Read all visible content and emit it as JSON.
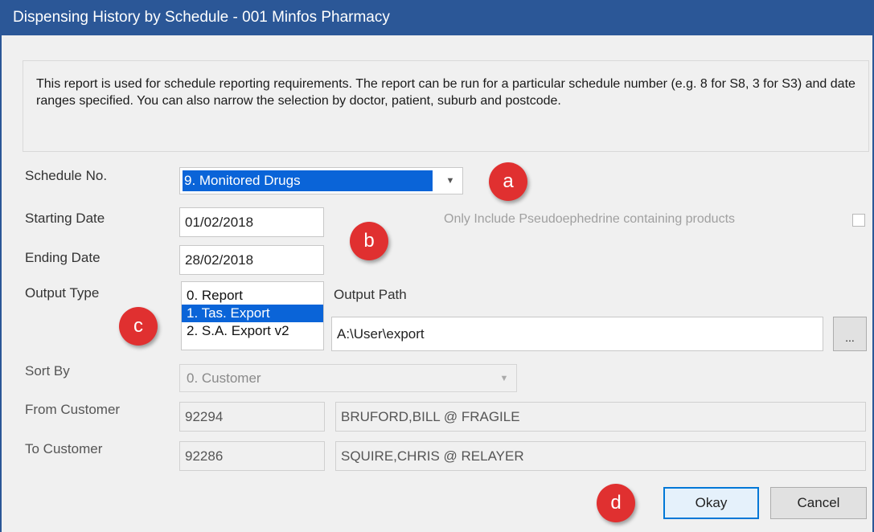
{
  "window": {
    "title": "Dispensing History by Schedule - 001 Minfos Pharmacy"
  },
  "info_text": "This report is used for schedule reporting requirements.  The report can be run for a particular schedule number (e.g. 8 for S8, 3 for S3) and date ranges specified. You can also narrow the selection by doctor, patient, suburb and postcode.",
  "form": {
    "schedule_label": "Schedule No.",
    "schedule_value": "9. Monitored Drugs",
    "starting_date_label": "Starting Date",
    "starting_date_value": "01/02/2018",
    "ending_date_label": "Ending Date",
    "ending_date_value": "28/02/2018",
    "pseudo_label": "Only Include Pseudoephedrine containing products",
    "output_type_label": "Output Type",
    "output_types": [
      "0. Report",
      "1. Tas. Export",
      "2. S.A. Export v2"
    ],
    "output_type_selected": "1. Tas. Export",
    "output_path_label": "Output Path",
    "output_path_value": "A:\\User\\export",
    "browse_label": "...",
    "sort_by_label": "Sort By",
    "sort_by_value": "0. Customer",
    "from_customer_label": "From Customer",
    "from_customer_id": "92294",
    "from_customer_name": "BRUFORD,BILL @ FRAGILE",
    "to_customer_label": "To Customer",
    "to_customer_id": "92286",
    "to_customer_name": "SQUIRE,CHRIS @ RELAYER"
  },
  "buttons": {
    "okay": "Okay",
    "cancel": "Cancel"
  },
  "badges": {
    "a": "a",
    "b": "b",
    "c": "c",
    "d": "d"
  },
  "colors": {
    "titlebar": "#2b5797",
    "selection": "#0a64d8",
    "badge": "#e03030"
  },
  "icons": {
    "dropdown": "chevron-down-icon",
    "checkbox": "checkbox-unchecked"
  }
}
